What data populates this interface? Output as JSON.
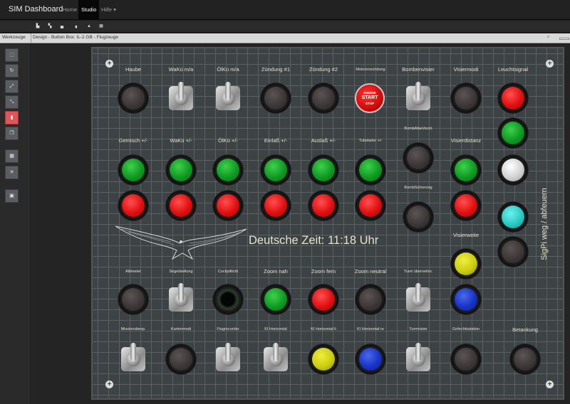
{
  "app": {
    "title": "SIM Dashboard"
  },
  "nav": {
    "home": "Home",
    "studio": "Studio",
    "help": "Hilfe ▾"
  },
  "toolbar": {
    "icons": [
      "align-left-icon",
      "align-center-icon",
      "align-bottom-icon",
      "distribute-icon",
      "lock-icon",
      "grid-icon"
    ]
  },
  "subbar": {
    "tools_label": "Werkzeuge",
    "design_title": "Design - Button Box: IL-2 GB - Flugzeuge",
    "zoom_icon": "zoom-icon"
  },
  "sidebar": {
    "icons": [
      "resize-icon",
      "rotate-icon",
      "expand-icon",
      "shrink-icon",
      "delete-icon",
      "copy-icon",
      "grid-icon",
      "close-icon",
      "image-icon"
    ]
  },
  "panel": {
    "clock_text": "Deutsche Zeit: 11:18 Uhr",
    "side_label": "SigPi weg / abfeuern",
    "engine_button": {
      "line1": "ENGINE",
      "line2": "START",
      "line3": "STOP"
    },
    "labels": {
      "haube": "Haube",
      "waku_ma": "WaKü m/a",
      "olku_ma": "ÖlKü m/a",
      "zundung1": "Zündung #1",
      "zundung2": "Zündung #2",
      "motorenzundung": "Motorenzündung",
      "bombenvisier": "Bombenvisier",
      "visiermodi": "Visiermodi",
      "leuchtsignal": "Leuchtsignal",
      "gemisch": "Gemisch +/-",
      "waku_pm": "WaKü +/-",
      "olku_pm": "ÖlKü +/-",
      "einlass": "Einlaß +/-",
      "auslass": "Auslaß +/-",
      "tubolader": "Tubolader +/-",
      "bombabwverzo": "BombAbwVerzö",
      "visierdistanz": "Visierdistanz",
      "bombsicherung": "BombSicherung",
      "visierweite": "Visierweite",
      "altimeter": "Altimeter",
      "segelstellung": "Segelstellung",
      "cockpitlicht": "Cockpitlicht",
      "zoom_nah": "Zoom nah",
      "zoom_fern": "Zoom fern",
      "zoom_neutral": "Zoom neutral",
      "turm_ubernehm": "Turm übernehm.",
      "missionsbesp": "Missionsbesp.",
      "kartenmodi": "Kartenmodi",
      "flugrecorder": "Flugrecorder",
      "ki_horizontal": "KI Horizontal",
      "ki_horizontal_li": "KI Horizontal li",
      "ki_horizontal_re": "KI Horizontal re",
      "turmvisier": "Turmvisier",
      "gefechtsstation": "Gefechtsstation",
      "betankung": "Betankung"
    }
  },
  "colors": {
    "panel_bg": "#3d4245",
    "label_text": "#e8e2c8",
    "green": "#0f9a22",
    "red": "#e00f10",
    "yellow": "#cccc10",
    "blue": "#1733c8",
    "teal": "#28cac4"
  }
}
